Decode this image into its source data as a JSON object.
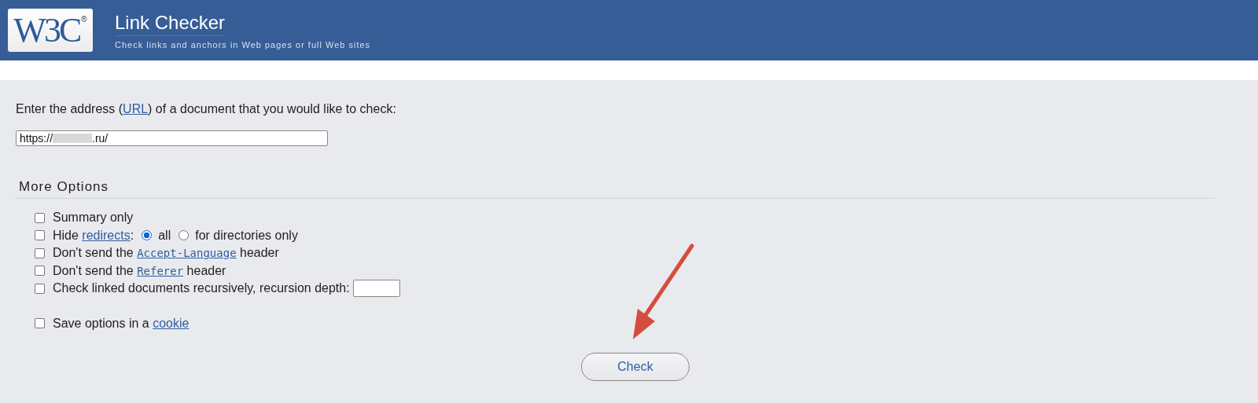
{
  "header": {
    "logo": {
      "text": "W3C",
      "mark": "®"
    },
    "title": "Link Checker",
    "subtitle": "Check links and anchors in Web pages or full Web sites"
  },
  "url_prompt": [
    {
      "kind": "text",
      "text": "Enter the address ("
    },
    {
      "kind": "link",
      "text": "URL"
    },
    {
      "kind": "text",
      "text": ") of a document that you would like to check:"
    }
  ],
  "url_field": {
    "value_start": "https://",
    "redacted": true,
    "value_end": ".ru/"
  },
  "more_options": {
    "title": "More Options",
    "options": [
      {
        "checked": false,
        "parts": [
          {
            "kind": "text",
            "text": "Summary only"
          }
        ]
      },
      {
        "checked": false,
        "parts": [
          {
            "kind": "text",
            "text": "Hide "
          },
          {
            "kind": "link",
            "text": "redirects"
          },
          {
            "kind": "text",
            "text": ":"
          },
          {
            "kind": "radio",
            "selected": true,
            "label": "all"
          },
          {
            "kind": "radio",
            "selected": false,
            "label": "for directories only"
          }
        ]
      },
      {
        "checked": false,
        "parts": [
          {
            "kind": "text",
            "text": "Don't send the "
          },
          {
            "kind": "code",
            "text": "Accept-Language"
          },
          {
            "kind": "text",
            "text": " header"
          }
        ]
      },
      {
        "checked": false,
        "parts": [
          {
            "kind": "text",
            "text": "Don't send the "
          },
          {
            "kind": "code",
            "text": "Referer"
          },
          {
            "kind": "text",
            "text": " header"
          }
        ]
      },
      {
        "checked": false,
        "parts": [
          {
            "kind": "text",
            "text": "Check linked documents recursively, recursion depth:"
          },
          {
            "kind": "field"
          }
        ]
      }
    ],
    "save_option": {
      "checked": false,
      "parts": [
        {
          "kind": "text",
          "text": "Save options in a "
        },
        {
          "kind": "link",
          "text": "cookie"
        }
      ]
    }
  },
  "submit": "Check"
}
